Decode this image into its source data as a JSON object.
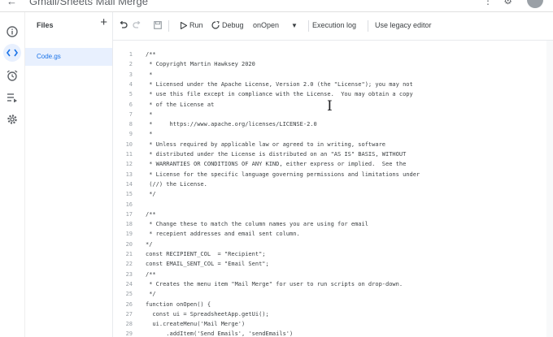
{
  "app": {
    "title": "Gmail/Sheets Mail Merge"
  },
  "rail": {
    "items": [
      "info-icon",
      "code-icon",
      "alarm-icon",
      "executions-icon",
      "settings-icon"
    ]
  },
  "files": {
    "header": "Files",
    "add": "+",
    "items": [
      {
        "name": "Code.gs"
      }
    ]
  },
  "toolbar": {
    "run": "Run",
    "debug": "Debug",
    "function": "onOpen",
    "execution_log": "Execution log",
    "legacy": "Use legacy editor"
  },
  "editor": {
    "line_numbers": [
      "1",
      "2",
      "3",
      "4",
      "5",
      "6",
      "7",
      "8",
      "9",
      "10",
      "11",
      "12",
      "13",
      "14",
      "15",
      "16",
      "17",
      "18",
      "19",
      "20",
      "21",
      "22",
      "23",
      "24",
      "25",
      "26",
      "27",
      "28",
      "29"
    ],
    "lines": [
      "/**",
      " * Copyright Martin Hawksey 2020",
      " *",
      " * Licensed under the Apache License, Version 2.0 (the \"License\"); you may not",
      " * use this file except in compliance with the License.  You may obtain a copy",
      " * of the License at",
      " *",
      " *     https://www.apache.org/licenses/LICENSE-2.0",
      " *",
      " * Unless required by applicable law or agreed to in writing, software",
      " * distributed under the License is distributed on an \"AS IS\" BASIS, WITHOUT",
      " * WARRANTIES OR CONDITIONS OF ANY KIND, either express or implied.  See the",
      " * License for the specific language governing permissions and limitations under",
      " (//) the License.",
      " */",
      "",
      "/**",
      " * Change these to match the column names you are using for email",
      " * recepient addresses and email sent column.",
      "*/",
      "const RECIPIENT_COL  = \"Recipient\";",
      "const EMAIL_SENT_COL = \"Email Sent\";",
      "/**",
      " * Creates the menu item \"Mail Merge\" for user to run scripts on drop-down.",
      " */",
      "function onOpen() {",
      "  const ui = SpreadsheetApp.getUi();",
      "  ui.createMenu('Mail Merge')",
      "      .addItem('Send Emails', 'sendEmails')"
    ]
  }
}
